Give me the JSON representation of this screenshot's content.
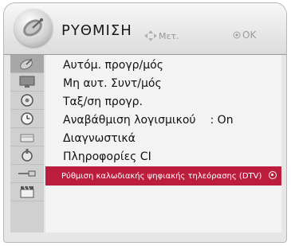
{
  "header": {
    "title": "ΡΥΘΜΙΣΗ",
    "move_hint": "Μετ.",
    "ok_hint": "OK",
    "icon": "satellite-dish-icon"
  },
  "sidebar": {
    "icons": [
      "satellite-icon",
      "tv-screen-icon",
      "gear-icon",
      "clock-icon",
      "lock-icon",
      "option-icon",
      "usb-icon",
      "clapper-icon"
    ],
    "active_index": 0
  },
  "menu": {
    "items": [
      {
        "label": "Αυτόμ. προγρ/μός"
      },
      {
        "label": "Μη αυτ. Συντ/μός"
      },
      {
        "label": "Ταξ/ση προγρ."
      },
      {
        "label": "Αναβάθμιση λογισμικού",
        "value": ": On"
      },
      {
        "label": "Διαγνωστικά"
      },
      {
        "label": "Πληροφορίες CI"
      },
      {
        "label": "Ρύθμιση καλωδιακής ψηφιακής τηλεόρασης (DTV)"
      }
    ],
    "selected_index": 6
  },
  "colors": {
    "selected": "#bd1d3c",
    "panel": "#f3f3f3"
  }
}
